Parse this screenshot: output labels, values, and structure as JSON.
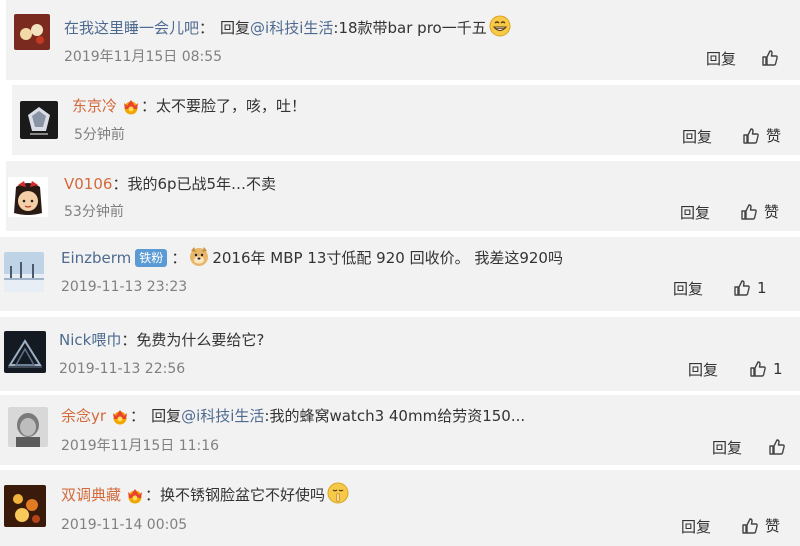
{
  "colors": {
    "card_bg": "#f2f2f2",
    "username": "#4e6b8f",
    "username_vip": "#d26a3c",
    "timestamp": "#808080",
    "badge_bg": "#5b9bd5"
  },
  "comments": [
    {
      "username": "在我这里睡一会儿吧",
      "colon": "：",
      "prefix": "回复",
      "mention": "@i科技i生活",
      "text": ":18款带bar pro一千五",
      "emoji": "grinning-face",
      "time": "2019年11月15日 08:55",
      "reply_label": "回复",
      "like_label": ""
    },
    {
      "username": "东京冷",
      "badge": "vip-crown-icon",
      "colon": "：",
      "text": "太不要脸了，咳，吐！",
      "time": "5分钟前",
      "reply_label": "回复",
      "like_label": "赞"
    },
    {
      "username": "V0106",
      "colon": "：",
      "text": "我的6p已战5年…不卖",
      "time": "53分钟前",
      "reply_label": "回复",
      "like_label": "赞"
    },
    {
      "username": "Einzberm",
      "pill": "铁粉",
      "colon": "：",
      "emoji": "doge-face",
      "text": " 2016年 MBP 13寸低配 920 回收价。  我差这920吗",
      "time": "2019-11-13 23:23",
      "reply_label": "回复",
      "like_label": "1"
    },
    {
      "username": "Nick喂巾",
      "colon": "：",
      "text": "免费为什么要给它?",
      "time": "2019-11-13 22:56",
      "reply_label": "回复",
      "like_label": "1"
    },
    {
      "username": "余念yr",
      "badge": "vip-crown-icon",
      "colon": "：",
      "prefix": "回复",
      "mention": "@i科技i生活",
      "text": ":我的蜂窝watch3 40mm给劳资150...",
      "time": "2019年11月15日 11:16",
      "reply_label": "回复",
      "like_label": ""
    },
    {
      "username": "双调典藏",
      "badge": "vip-crown-icon",
      "colon": "：",
      "text": "换不锈钢脸盆它不好使吗",
      "emoji": "shushing-face",
      "time": "2019-11-14 00:05",
      "reply_label": "回复",
      "like_label": "赞"
    }
  ]
}
